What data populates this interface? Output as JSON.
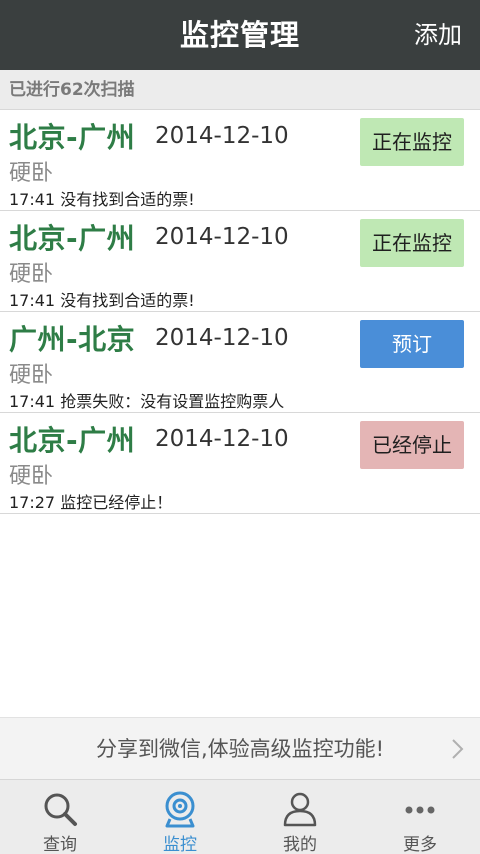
{
  "header": {
    "title": "监控管理",
    "add_label": "添加"
  },
  "scan": {
    "text": "已进行62次扫描"
  },
  "items": [
    {
      "route": "北京-广州",
      "date": "2014-12-10",
      "seat": "硬卧",
      "status": "17:41 没有找到合适的票!",
      "button": "正在监控",
      "button_state": "monitoring"
    },
    {
      "route": "北京-广州",
      "date": "2014-12-10",
      "seat": "硬卧",
      "status": "17:41 没有找到合适的票!",
      "button": "正在监控",
      "button_state": "monitoring"
    },
    {
      "route": "广州-北京",
      "date": "2014-12-10",
      "seat": "硬卧",
      "status": "17:41 抢票失败：没有设置监控购票人",
      "button": "预订",
      "button_state": "book"
    },
    {
      "route": "北京-广州",
      "date": "2014-12-10",
      "seat": "硬卧",
      "status": "17:27 监控已经停止！",
      "button": "已经停止",
      "button_state": "stopped"
    }
  ],
  "share": {
    "text": "分享到微信,体验高级监控功能!"
  },
  "tabs": [
    {
      "label": "查询",
      "icon": "search-icon",
      "active": false
    },
    {
      "label": "监控",
      "icon": "webcam-icon",
      "active": true
    },
    {
      "label": "我的",
      "icon": "user-icon",
      "active": false
    },
    {
      "label": "更多",
      "icon": "more-icon",
      "active": false
    }
  ],
  "colors": {
    "header_bg": "#3a3f3f",
    "route_green": "#2e7d46",
    "monitoring_bg": "#bfe8b4",
    "book_bg": "#4a8ed8",
    "stopped_bg": "#e4b5b5",
    "tab_active": "#3b8fd0"
  }
}
